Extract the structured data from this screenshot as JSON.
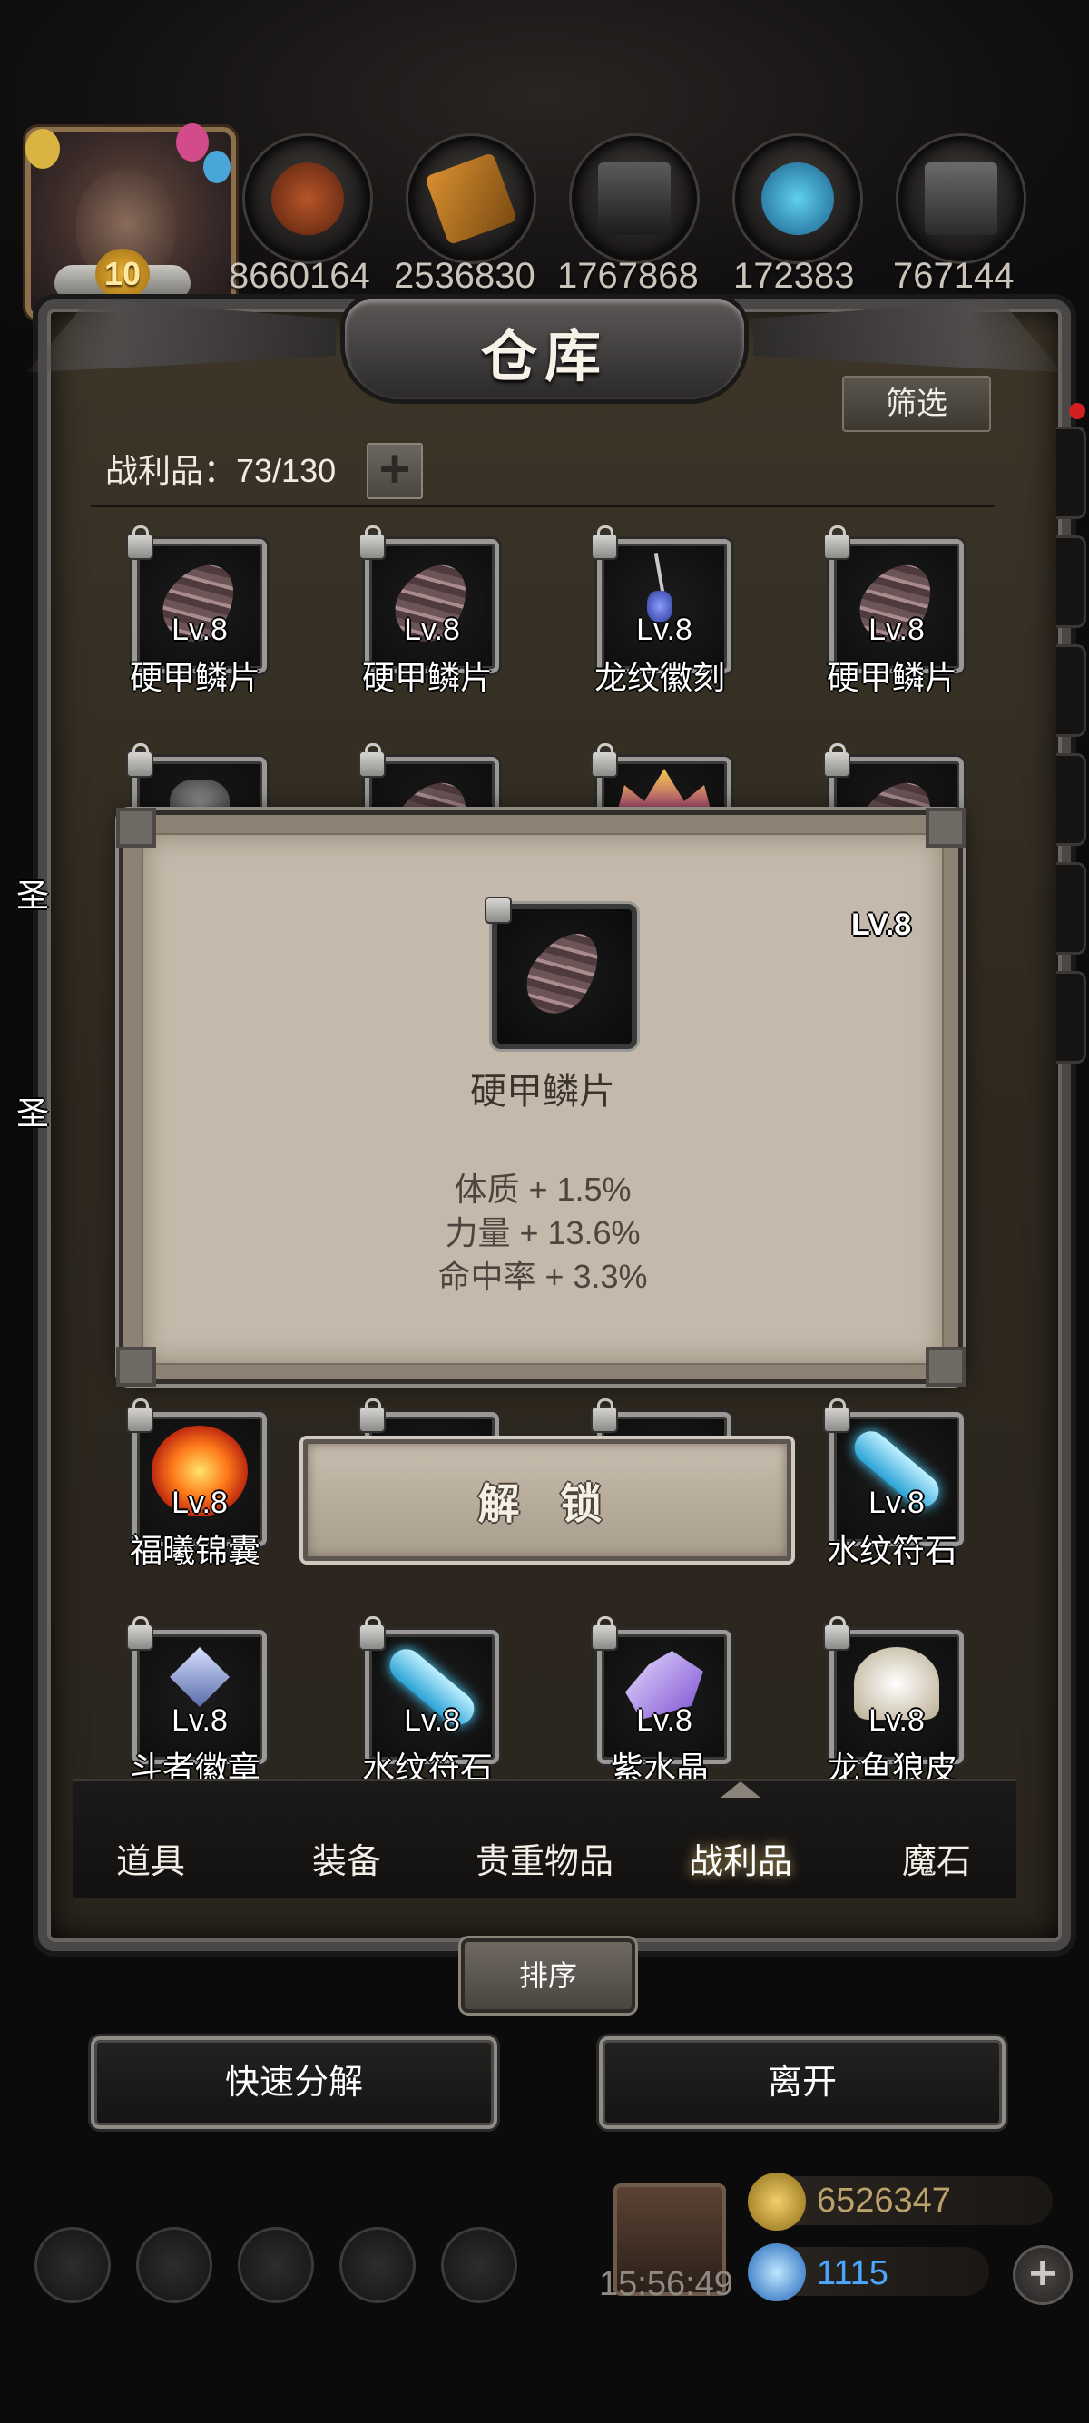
{
  "header": {
    "title": "仓库",
    "avatar_level": "10",
    "resources": [
      "8660164",
      "2536830",
      "1767868",
      "172383",
      "767144"
    ],
    "resource_icons": [
      "meat-icon",
      "wood-icon",
      "iron-ingot-icon",
      "crystal-icon",
      "steel-icon"
    ]
  },
  "toolbar": {
    "filter_label": "筛选",
    "capacity_label": "战利品：73/130",
    "add_label": "+"
  },
  "grid": {
    "items": [
      {
        "lv": "Lv.8",
        "name": "硬甲鳞片",
        "icon": "scale-icon"
      },
      {
        "lv": "Lv.8",
        "name": "硬甲鳞片",
        "icon": "scale-icon"
      },
      {
        "lv": "Lv.8",
        "name": "龙纹徽刻",
        "icon": "necklace-icon"
      },
      {
        "lv": "Lv.8",
        "name": "硬甲鳞片",
        "icon": "scale-icon"
      },
      {
        "lv": "Lv.8",
        "name": "福曦锦囊",
        "icon": "flame-pouch-icon"
      },
      {
        "lv": "Lv.8",
        "name": "水纹符石",
        "icon": "rune-stone-icon"
      },
      {
        "lv": "Lv.8",
        "name": "斗者徽章",
        "icon": "emblem-icon"
      },
      {
        "lv": "Lv.8",
        "name": "水纹符石",
        "icon": "rune-stone-icon"
      },
      {
        "lv": "Lv.8",
        "name": "紫水晶",
        "icon": "amethyst-icon"
      },
      {
        "lv": "Lv.8",
        "name": "龙鱼狼皮",
        "icon": "fur-icon"
      }
    ],
    "partial_names": [
      "圣",
      "圣"
    ]
  },
  "tooltip": {
    "level": "LV.8",
    "name": "硬甲鳞片",
    "stats": [
      "体质 + 1.5%",
      "力量 + 13.6%",
      "命中率 + 3.3%"
    ]
  },
  "unlock_label": "解 锁",
  "tabs": [
    {
      "label": "道具",
      "active": false
    },
    {
      "label": "装备",
      "active": false
    },
    {
      "label": "贵重物品",
      "active": false
    },
    {
      "label": "战利品",
      "active": true
    },
    {
      "label": "魔石",
      "active": false
    }
  ],
  "sort_label": "排序",
  "actions": {
    "quick_decompose": "快速分解",
    "leave": "离开"
  },
  "hud": {
    "timer": "15:56:49",
    "gold": "6526347",
    "gems": "1115"
  },
  "colors": {
    "gold_text": "#bba16a",
    "gem_text": "#4aa8ff",
    "panel_bg": "#2e281f",
    "tooltip_bg": "#c4b9aa"
  }
}
